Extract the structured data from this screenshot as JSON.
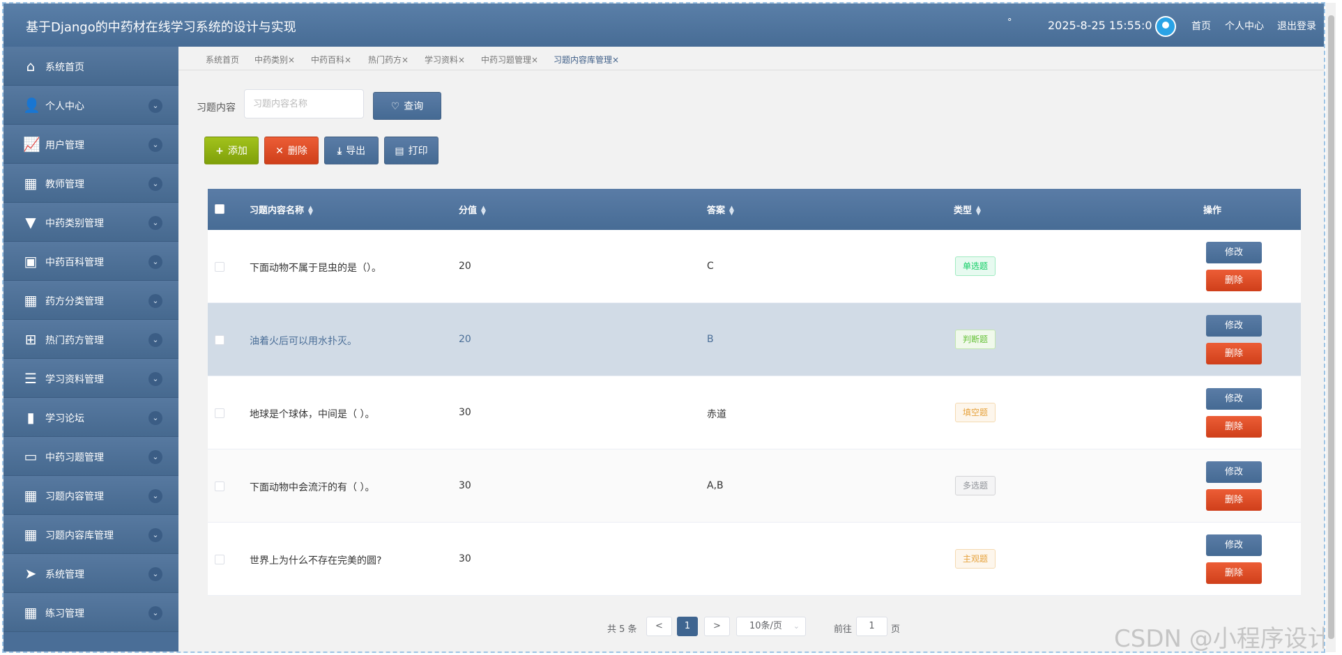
{
  "header": {
    "title": "基于Django的中药材在线学习系统的设计与实现",
    "degree": "°",
    "datetime": "2025-8-25 15:55:0",
    "links": [
      "首页",
      "个人中心",
      "退出登录"
    ]
  },
  "sidebar": {
    "items": [
      {
        "label": "系统首页",
        "icon": "home-icon",
        "chevron": false
      },
      {
        "label": "个人中心",
        "icon": "user-icon",
        "chevron": true
      },
      {
        "label": "用户管理",
        "icon": "line-chart-icon",
        "chevron": true
      },
      {
        "label": "教师管理",
        "icon": "grid-icon",
        "chevron": true
      },
      {
        "label": "中药类别管理",
        "icon": "brush-icon",
        "chevron": true
      },
      {
        "label": "中药百科管理",
        "icon": "wallet-icon",
        "chevron": true
      },
      {
        "label": "药方分类管理",
        "icon": "grid-icon",
        "chevron": true
      },
      {
        "label": "热门药方管理",
        "icon": "apps-icon",
        "chevron": true
      },
      {
        "label": "学习资料管理",
        "icon": "list-icon",
        "chevron": true
      },
      {
        "label": "学习论坛",
        "icon": "bar-chart-icon",
        "chevron": true
      },
      {
        "label": "中药习题管理",
        "icon": "briefcase-icon",
        "chevron": true
      },
      {
        "label": "习题内容管理",
        "icon": "grid-icon",
        "chevron": true
      },
      {
        "label": "习题内容库管理",
        "icon": "grid-icon",
        "chevron": true
      },
      {
        "label": "系统管理",
        "icon": "send-icon",
        "chevron": true
      },
      {
        "label": "练习管理",
        "icon": "grid-icon",
        "chevron": true
      }
    ],
    "chevron_glyph": "⌄"
  },
  "tabs": [
    {
      "label": "系统首页",
      "closable": false
    },
    {
      "label": "中药类别",
      "closable": true
    },
    {
      "label": "中药百科",
      "closable": true
    },
    {
      "label": "热门药方",
      "closable": true
    },
    {
      "label": "学习资料",
      "closable": true
    },
    {
      "label": "中药习题管理",
      "closable": true
    },
    {
      "label": "习题内容库管理",
      "closable": true,
      "active": true
    }
  ],
  "search": {
    "label": "习题内容",
    "placeholder": "习题内容名称",
    "button": "查询"
  },
  "toolbar": {
    "add": "添加",
    "delete": "删除",
    "export": "导出",
    "print": "打印"
  },
  "table": {
    "columns": [
      "习题内容名称",
      "分值",
      "答案",
      "类型",
      "操作"
    ],
    "rows": [
      {
        "name": "下面动物不属于昆虫的是（）。",
        "score": "20",
        "answer": "C",
        "type": "单选题",
        "tagColor": "#13ce66",
        "tagBg": "#e7faf0",
        "tagBorder": "#a0ebc2"
      },
      {
        "name": "油着火后可以用水扑灭。",
        "score": "20",
        "answer": "B",
        "type": "判断题",
        "tagColor": "#67c23a",
        "tagBg": "#f0f9eb",
        "tagBorder": "#c2e7b0"
      },
      {
        "name": "地球是个球体，中间是（ ）。",
        "score": "30",
        "answer": "赤道",
        "type": "填空题",
        "tagColor": "#e6a23c",
        "tagBg": "#fdf6ec",
        "tagBorder": "#f5dab1"
      },
      {
        "name": "下面动物中会流汗的有（ ）。",
        "score": "30",
        "answer": "A,B",
        "type": "多选题",
        "tagColor": "#909399",
        "tagBg": "#f4f4f5",
        "tagBorder": "#d3d4d6"
      },
      {
        "name": "世界上为什么不存在完美的圆?",
        "score": "30",
        "answer": "",
        "type": "主观题",
        "tagColor": "#e6a23c",
        "tagBg": "#fdf6ec",
        "tagBorder": "#f5dab1"
      }
    ],
    "edit_label": "修改",
    "delete_label": "删除"
  },
  "pagination": {
    "total": "共 5 条",
    "prev": "<",
    "current": "1",
    "next": ">",
    "page_size": "10条/页",
    "goto_label": "前往",
    "goto_value": "1",
    "page_suffix": "页"
  },
  "watermark": "CSDN @小程序设计"
}
